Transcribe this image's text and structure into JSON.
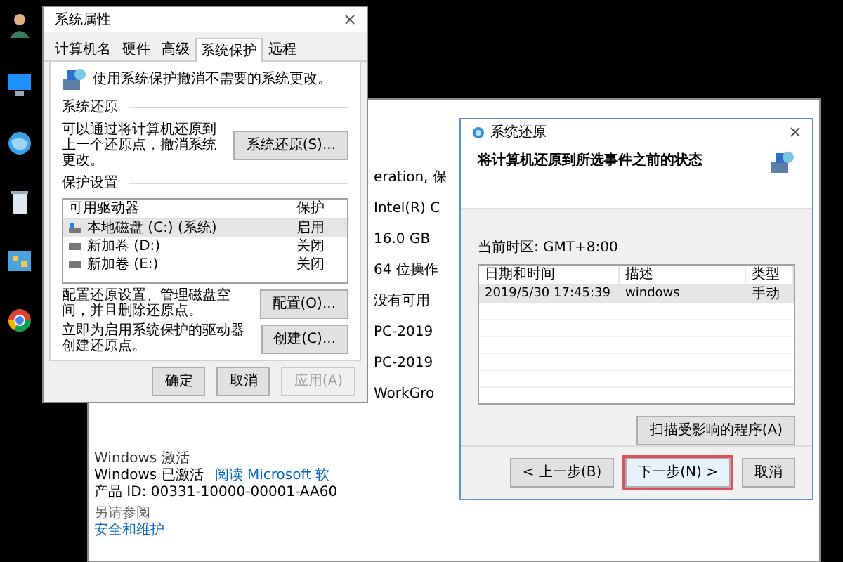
{
  "desktop_icons": [
    {
      "kind": "user"
    },
    {
      "kind": "monitor"
    },
    {
      "kind": "globe"
    },
    {
      "kind": "trash"
    },
    {
      "kind": "panel"
    },
    {
      "kind": "browser"
    }
  ],
  "background_window": {
    "fragments": [
      "eration, 保",
      "Intel(R) C",
      "16.0 GB",
      "64 位操作",
      "没有可用",
      "PC-2019",
      "PC-2019",
      "WorkGro"
    ],
    "activation_heading": "Windows 激活",
    "activation_status": "Windows 已激活",
    "license_link": "阅读 Microsoft 软",
    "product_id": "产品 ID: 00331-10000-00001-AA60",
    "see_also": "另请参阅",
    "security_link": "安全和维护"
  },
  "system_properties": {
    "title": "系统属性",
    "tabs": [
      {
        "label": "计算机名",
        "selected": false
      },
      {
        "label": "硬件",
        "selected": false
      },
      {
        "label": "高级",
        "selected": false
      },
      {
        "label": "系统保护",
        "selected": true
      },
      {
        "label": "远程",
        "selected": false
      }
    ],
    "intro": "使用系统保护撤消不需要的系统更改。",
    "restore_section": "系统还原",
    "restore_text": "可以通过将计算机还原到上一个还原点，撤消系统更改。",
    "restore_button": "系统还原(S)...",
    "protection_section": "保护设置",
    "drive_columns": [
      "可用驱动器",
      "保护"
    ],
    "drives": [
      {
        "name": "本地磁盘 (C:) (系统)",
        "protection": "启用",
        "kind": "system",
        "selected": true
      },
      {
        "name": "新加卷 (D:)",
        "protection": "关闭",
        "kind": "data",
        "selected": false
      },
      {
        "name": "新加卷 (E:)",
        "protection": "关闭",
        "kind": "data",
        "selected": false
      }
    ],
    "configure_text": "配置还原设置、管理磁盘空间，并且删除还原点。",
    "configure_button": "配置(O)...",
    "create_text": "立即为启用系统保护的驱动器创建还原点。",
    "create_button": "创建(C)...",
    "buttons": [
      {
        "label": "确定",
        "disabled": false
      },
      {
        "label": "取消",
        "disabled": false
      },
      {
        "label": "应用(A)",
        "disabled": true
      }
    ]
  },
  "restore_dialog": {
    "title": "系统还原",
    "heading": "将计算机还原到所选事件之前的状态",
    "timezone": "当前时区: GMT+8:00",
    "columns": [
      "日期和时间",
      "描述",
      "类型"
    ],
    "rows": [
      {
        "date": "2019/5/30 17:45:39",
        "description": "windows",
        "type": "手动",
        "selected": true
      }
    ],
    "scan_button": "扫描受影响的程序(A)",
    "buttons": [
      {
        "label": "< 上一步(B)",
        "highlighted": false
      },
      {
        "label": "下一步(N) >",
        "highlighted": true
      },
      {
        "label": "取消",
        "highlighted": false
      }
    ]
  }
}
